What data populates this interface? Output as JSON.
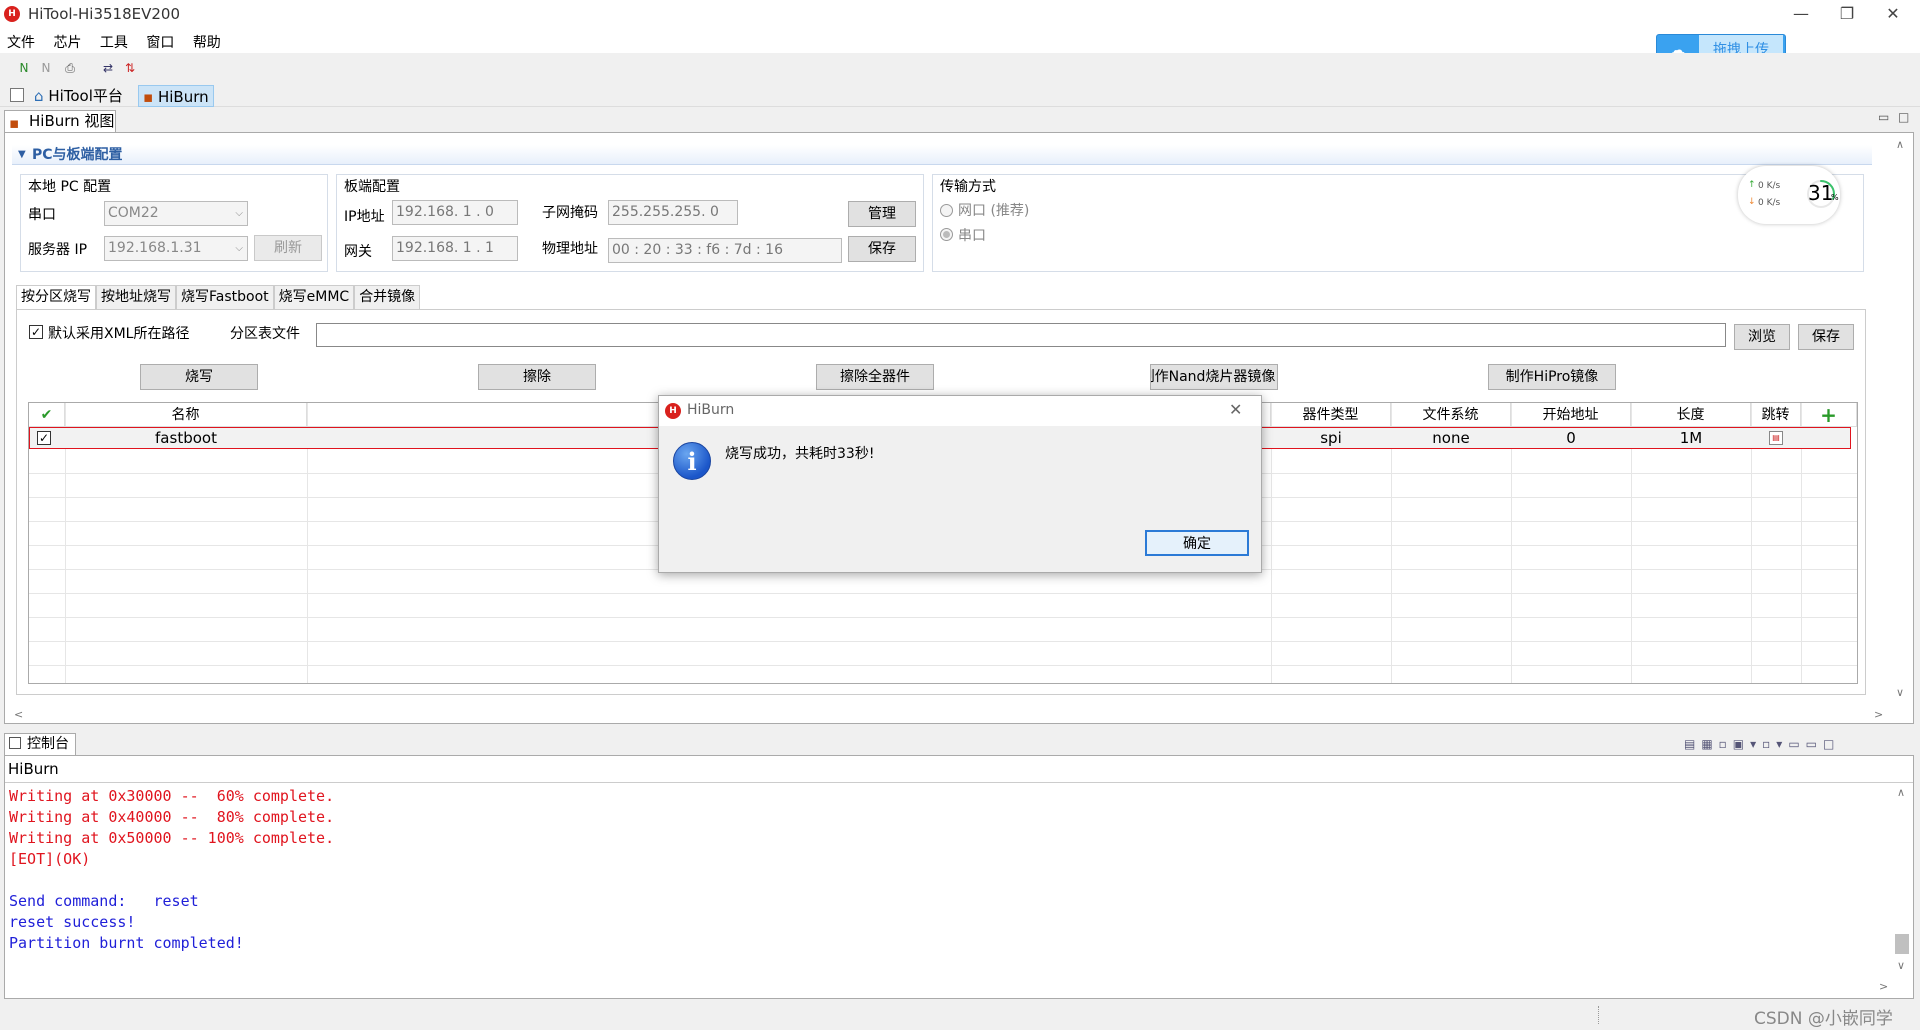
{
  "window": {
    "title": "HiTool-Hi3518EV200",
    "logo": "hitool-logo",
    "controls": [
      "—",
      "❐",
      "✕"
    ]
  },
  "menu": [
    "文件",
    "芯片",
    "工具",
    "窗口",
    "帮助"
  ],
  "upload_button": {
    "label": "拖拽上传",
    "icon": "cloud-icon"
  },
  "perspectives": [
    {
      "label": "HiTool平台",
      "active": false
    },
    {
      "label": "HiBurn",
      "active": true
    }
  ],
  "view_tab": "HiBurn 视图",
  "section_title": "PC与板端配置",
  "local_pc": {
    "title": "本地 PC 配置",
    "port_label": "串口",
    "port_value": "COM22",
    "server_ip_label": "服务器 IP",
    "server_ip_value": "192.168.1.31",
    "refresh_label": "刷新"
  },
  "board": {
    "title": "板端配置",
    "ip_label": "IP地址",
    "ip_value": "192.168. 1 . 0",
    "subnet_label": "子网掩码",
    "subnet_value": "255.255.255. 0",
    "gateway_label": "网关",
    "gateway_value": "192.168. 1 . 1",
    "mac_label": "物理地址",
    "mac_value": "00 : 20 : 33 : f6 : 7d : 16",
    "manage_label": "管理",
    "save_label": "保存"
  },
  "transfer": {
    "title": "传输方式",
    "network_label": "网口 (推荐)",
    "serial_label": "串口"
  },
  "net_widget": {
    "up": "0  K/s",
    "down": "0  K/s",
    "percent": "31",
    "percent_unit": "%"
  },
  "tabs": [
    "按分区烧写",
    "按地址烧写",
    "烧写Fastboot",
    "烧写eMMC",
    "合并镜像"
  ],
  "xml_path": {
    "checkbox_label": "默认采用XML所在路径",
    "file_label": "分区表文件",
    "value": "",
    "browse_label": "浏览",
    "save_label": "保存"
  },
  "actions": [
    "烧写",
    "擦除",
    "擦除全器件",
    "制作Nand烧片器镜像",
    "制作HiPro镜像"
  ],
  "table": {
    "headers": {
      "name": "名称",
      "device_type": "器件类型",
      "file_system": "文件系统",
      "start_address": "开始地址",
      "length": "长度",
      "jump": "跳转"
    },
    "rows": [
      {
        "name": "fastboot",
        "device_type": "spi",
        "file_system": "none",
        "start_address": "0",
        "length": "1M"
      }
    ]
  },
  "dialog": {
    "title": "HiBurn",
    "message": "烧写成功，共耗时33秒!",
    "ok_label": "确定"
  },
  "console": {
    "tab_label": "控制台",
    "header": "HiBurn",
    "lines": [
      {
        "text": "Writing at 0x30000 --  60% complete.",
        "color": "#e0141e"
      },
      {
        "text": "Writing at 0x40000 --  80% complete.",
        "color": "#e0141e"
      },
      {
        "text": "Writing at 0x50000 -- 100% complete.",
        "color": "#e0141e"
      },
      {
        "text": "[EOT](OK)",
        "color": "#e0141e"
      },
      {
        "text": "",
        "color": "#1f1fd8"
      },
      {
        "text": "Send command:   reset",
        "color": "#1f1fd8"
      },
      {
        "text": "reset success!",
        "color": "#1f1fd8"
      },
      {
        "text": "Partition burnt completed!",
        "color": "#1f1fd8"
      }
    ]
  },
  "watermark": "CSDN @小嵌同学"
}
